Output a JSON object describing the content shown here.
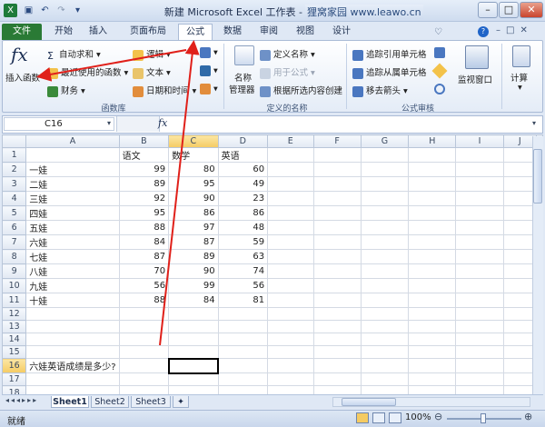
{
  "titlebar": {
    "title": "新建 Microsoft Excel 工作表 - Microsoft Excel",
    "watermark": "狸窝家园 www.leawo.cn"
  },
  "tabs": [
    "文件",
    "开始",
    "插入",
    "页面布局",
    "公式",
    "数据",
    "审阅",
    "视图",
    "设计"
  ],
  "ribbon": {
    "insert_function": "插入函数",
    "autosum": "自动求和",
    "recent": "最近使用的函数",
    "finance": "财务",
    "logic": "逻辑",
    "text": "文本",
    "datetime": "日期和时间",
    "group_library": "函数库",
    "name_manager_1": "名称",
    "name_manager_2": "管理器",
    "define_name": "定义名称",
    "use_in_formula": "用于公式",
    "create_from_selection": "根据所选内容创建",
    "group_names": "定义的名称",
    "trace_precedents": "追踪引用单元格",
    "trace_dependents": "追踪从属单元格",
    "remove_arrows": "移去箭头",
    "group_audit": "公式审核",
    "watch_window": "监视窗口",
    "calculation": "计算"
  },
  "formula_bar": {
    "name_box": "C16",
    "fx": "fx",
    "value": ""
  },
  "grid": {
    "columns": [
      "A",
      "B",
      "C",
      "D",
      "E",
      "F",
      "G",
      "H",
      "I",
      "J"
    ],
    "rows": [
      [
        "",
        "语文",
        "数学",
        "英语"
      ],
      [
        "一娃",
        "99",
        "80",
        "60"
      ],
      [
        "二娃",
        "89",
        "95",
        "49"
      ],
      [
        "三娃",
        "92",
        "90",
        "23"
      ],
      [
        "四娃",
        "95",
        "86",
        "86"
      ],
      [
        "五娃",
        "88",
        "97",
        "48"
      ],
      [
        "六娃",
        "84",
        "87",
        "59"
      ],
      [
        "七娃",
        "87",
        "89",
        "63"
      ],
      [
        "八娃",
        "70",
        "90",
        "74"
      ],
      [
        "九娃",
        "56",
        "99",
        "56"
      ],
      [
        "十娃",
        "88",
        "84",
        "81"
      ],
      [
        "",
        "",
        "",
        ""
      ],
      [
        "",
        "",
        "",
        ""
      ],
      [
        "",
        "",
        "",
        ""
      ],
      [
        "",
        "",
        "",
        ""
      ],
      [
        "六娃英语成绩是多少?",
        "",
        "",
        ""
      ],
      [
        "",
        "",
        "",
        ""
      ],
      [
        "",
        "",
        "",
        ""
      ],
      [
        "",
        "",
        "",
        ""
      ],
      [
        "",
        "",
        "",
        ""
      ]
    ],
    "active_cell": "C16"
  },
  "sheets": [
    "Sheet1",
    "Sheet2",
    "Sheet3"
  ],
  "status": {
    "ready": "就绪",
    "zoom": "100%"
  },
  "colors": {
    "file_tab": "#2a7a35",
    "arrow": "#e0201a",
    "active_header": "#f5cb62"
  }
}
